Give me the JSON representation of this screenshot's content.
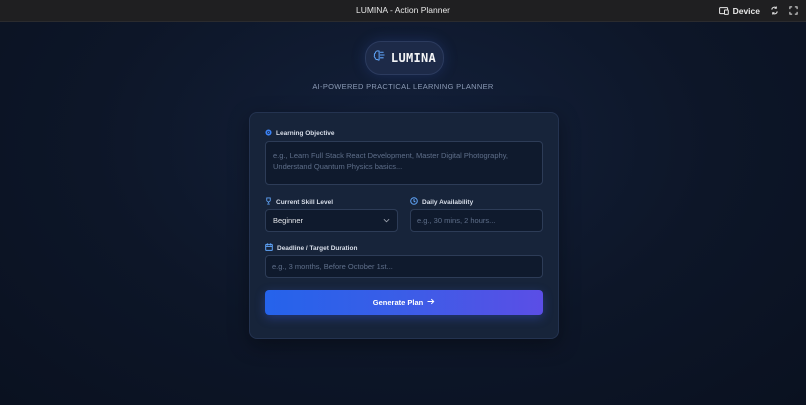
{
  "window": {
    "title": "LUMINA - Action Planner",
    "device_label": "Device"
  },
  "brand": {
    "name": "LUMINA",
    "tagline": "AI-POWERED PRACTICAL LEARNING PLANNER",
    "accent": "#3b82f6"
  },
  "form": {
    "objective": {
      "label": "Learning Objective",
      "placeholder": "e.g., Learn Full Stack React Development, Master Digital Photography, Understand Quantum Physics basics...",
      "value": ""
    },
    "skill": {
      "label": "Current Skill Level",
      "value": "Beginner"
    },
    "availability": {
      "label": "Daily Availability",
      "placeholder": "e.g., 30 mins, 2 hours...",
      "value": ""
    },
    "deadline": {
      "label": "Deadline / Target Duration",
      "placeholder": "e.g., 3 months, Before October 1st...",
      "value": ""
    },
    "submit_label": "Generate Plan"
  }
}
